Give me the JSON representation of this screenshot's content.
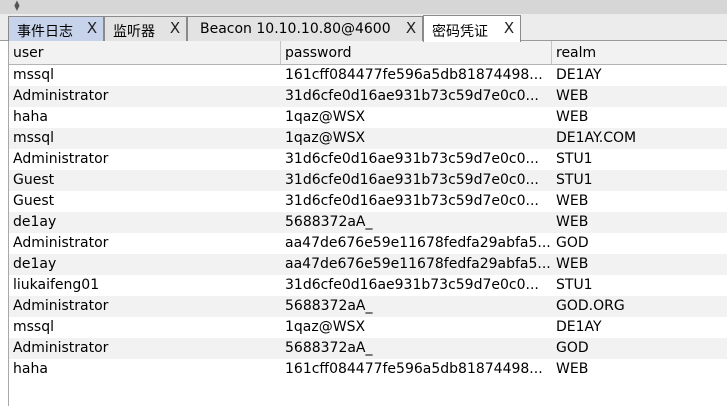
{
  "tabs": [
    {
      "label": "事件日志",
      "close": "X"
    },
    {
      "label": "监听器",
      "close": "X"
    },
    {
      "label": "Beacon 10.10.10.80@4600",
      "close": "X"
    },
    {
      "label": "密码凭证",
      "close": "X"
    }
  ],
  "table": {
    "columns": [
      "user",
      "password",
      "realm"
    ],
    "rows": [
      {
        "user": "mssql",
        "password": "161cff084477fe596a5db81874498...",
        "realm": "DE1AY"
      },
      {
        "user": "Administrator",
        "password": "31d6cfe0d16ae931b73c59d7e0c0...",
        "realm": "WEB"
      },
      {
        "user": "haha",
        "password": "1qaz@WSX",
        "realm": "WEB"
      },
      {
        "user": "mssql",
        "password": "1qaz@WSX",
        "realm": "DE1AY.COM"
      },
      {
        "user": "Administrator",
        "password": "31d6cfe0d16ae931b73c59d7e0c0...",
        "realm": "STU1"
      },
      {
        "user": "Guest",
        "password": "31d6cfe0d16ae931b73c59d7e0c0...",
        "realm": "STU1"
      },
      {
        "user": "Guest",
        "password": "31d6cfe0d16ae931b73c59d7e0c0...",
        "realm": "WEB"
      },
      {
        "user": "de1ay",
        "password": "5688372aA_",
        "realm": "WEB"
      },
      {
        "user": "Administrator",
        "password": "aa47de676e59e11678fedfa29abfa5...",
        "realm": "GOD"
      },
      {
        "user": "de1ay",
        "password": "aa47de676e59e11678fedfa29abfa5...",
        "realm": "WEB"
      },
      {
        "user": "liukaifeng01",
        "password": "31d6cfe0d16ae931b73c59d7e0c0...",
        "realm": "STU1"
      },
      {
        "user": "Administrator",
        "password": "5688372aA_",
        "realm": "GOD.ORG"
      },
      {
        "user": "mssql",
        "password": "1qaz@WSX",
        "realm": "DE1AY"
      },
      {
        "user": "Administrator",
        "password": "5688372aA_",
        "realm": "GOD"
      },
      {
        "user": "haha",
        "password": "161cff084477fe596a5db81874498...",
        "realm": "WEB"
      }
    ]
  },
  "colors": {
    "tab_highlight": "#c7d3ea",
    "row_alt": "#f2f2f2"
  }
}
